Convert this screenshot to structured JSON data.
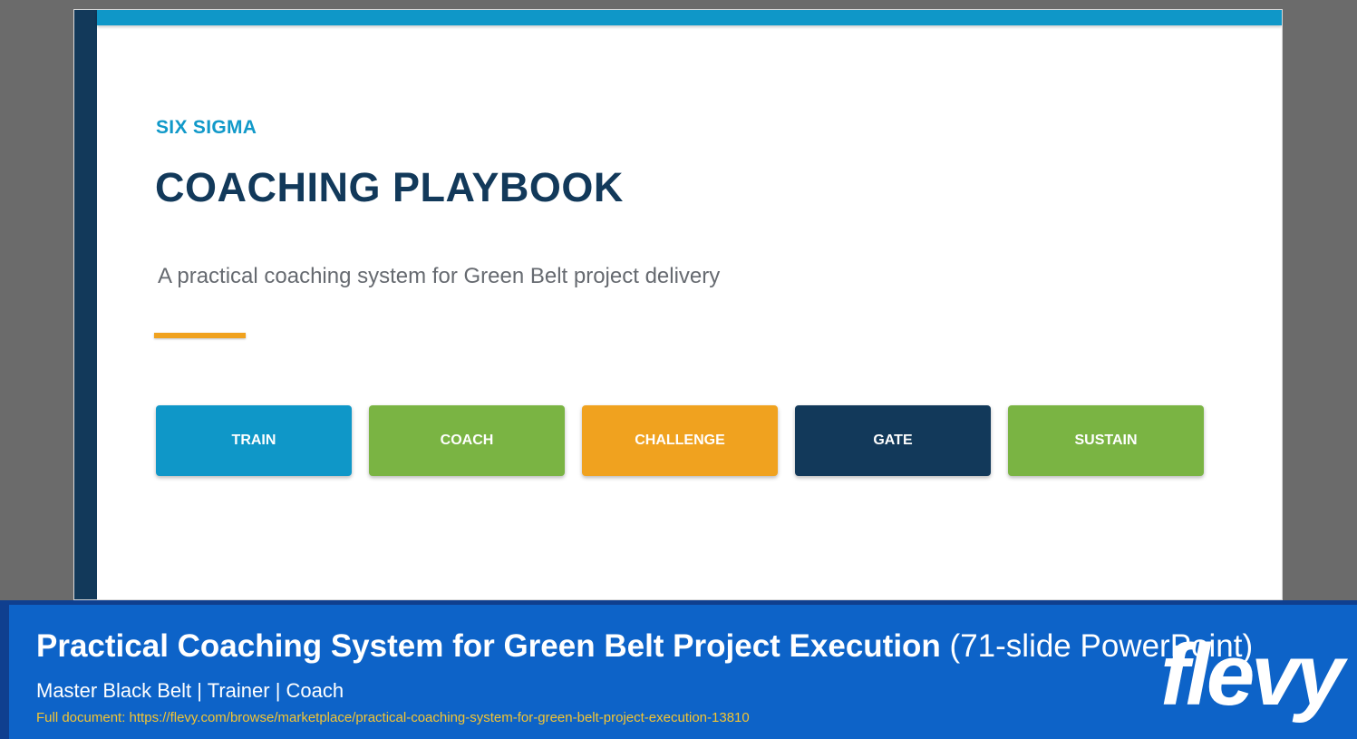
{
  "slide": {
    "eyebrow": "SIX SIGMA",
    "title": "COACHING PLAYBOOK",
    "subtitle": "A practical coaching system for Green Belt project delivery",
    "pills": [
      "TRAIN",
      "COACH",
      "CHALLENGE",
      "GATE",
      "SUSTAIN"
    ]
  },
  "footer": {
    "title_main": "Practical Coaching System for Green Belt Project Execution",
    "title_meta": "(71-slide PowerPoint)",
    "author": "Master Black Belt | Trainer | Coach",
    "link_text": "Full document: https://flevy.com/browse/marketplace/practical-coaching-system-for-green-belt-project-execution-13810",
    "logo_text": "flevy"
  },
  "colors": {
    "navy": "#12395a",
    "cyan": "#0f97c8",
    "green": "#7ab443",
    "orange": "#f0a21f",
    "footer_blue": "#0d63c8",
    "link_yellow": "#f3c433"
  }
}
